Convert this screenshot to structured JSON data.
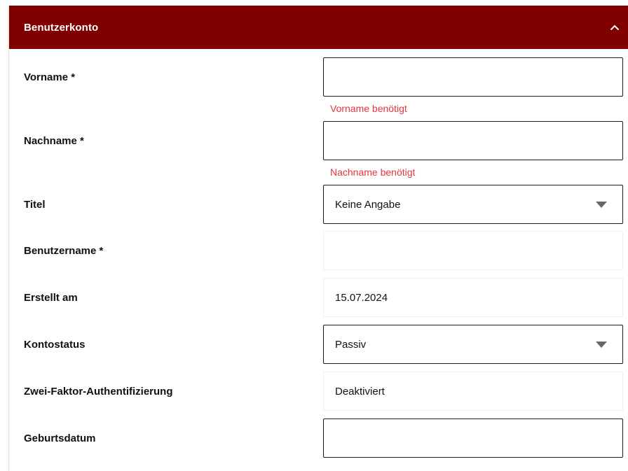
{
  "section": {
    "title": "Benutzerkonto",
    "collapse_icon": "chevron-up-icon"
  },
  "fields": {
    "vorname": {
      "label": "Vorname *",
      "value": "",
      "error": "Vorname benötigt"
    },
    "nachname": {
      "label": "Nachname *",
      "value": "",
      "error": "Nachname benötigt"
    },
    "titel": {
      "label": "Titel",
      "value": "Keine Angabe"
    },
    "benutzername": {
      "label": "Benutzername *",
      "value": ""
    },
    "erstellt_am": {
      "label": "Erstellt am",
      "value": "15.07.2024"
    },
    "kontostatus": {
      "label": "Kontostatus",
      "value": "Passiv"
    },
    "zwei_faktor": {
      "label": "Zwei-Faktor-Authentifizierung",
      "value": "Deaktiviert"
    },
    "geburtsdatum": {
      "label": "Geburtsdatum",
      "value": ""
    }
  },
  "colors": {
    "header_background": "#800000",
    "header_text": "#ffffff",
    "error_text": "#e0363f"
  }
}
